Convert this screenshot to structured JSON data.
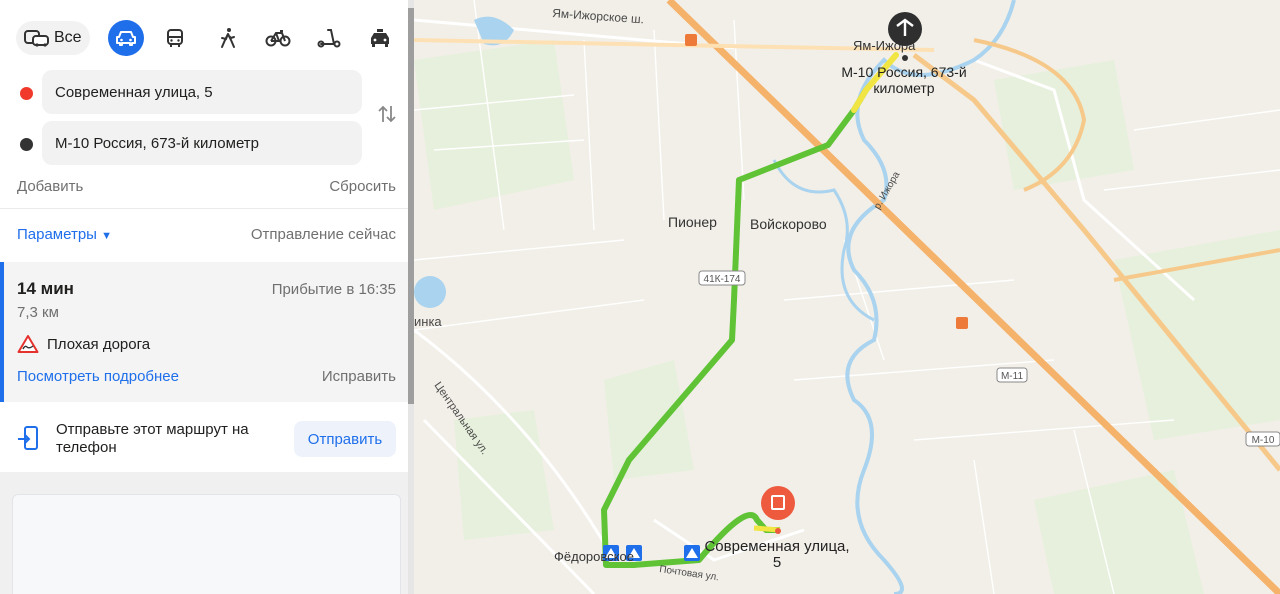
{
  "modes": {
    "all_label": "Все",
    "items": [
      "car-icon",
      "bus-icon",
      "walk-icon",
      "bicycle-icon",
      "scooter-icon",
      "taxi-icon"
    ],
    "active": "car-icon"
  },
  "route": {
    "from": "Современная улица, 5",
    "to": "М-10 Россия, 673-й километр",
    "add_label": "Добавить",
    "reset_label": "Сбросить"
  },
  "params": {
    "label": "Параметры",
    "departure": "Отправление сейчас"
  },
  "result": {
    "time": "14 мин",
    "distance": "7,3 км",
    "arrival": "Прибытие в 16:35",
    "warning": "Плохая дорога",
    "details_link": "Посмотреть подробнее",
    "fix_link": "Исправить"
  },
  "send": {
    "text": "Отправьте этот маршрут на телефон",
    "button": "Отправить"
  },
  "map": {
    "labels": {
      "road_north": "Ям-Ижорское ш.",
      "town_yam": "Ям-Ижора",
      "dest_line1": "М-10 Россия, 673-й",
      "dest_line2": "километр",
      "pioner": "Пионер",
      "voiskorovo": "Войскорово",
      "road_41k": "41К-174",
      "river": "р. Ижора",
      "inka": "инка",
      "central_st": "Центральная ул.",
      "m11": "М-11",
      "m10": "М-10",
      "fedorovskoe": "Фёдоровское",
      "pochtovaya": "Почтовая ул.",
      "origin_line1": "Современная улица,",
      "origin_line2": "5"
    },
    "colors": {
      "route_main": "#5fc335",
      "route_slow": "#f0e542",
      "highway": "#f5b26b",
      "accent": "#1f6feb",
      "origin_pin": "#ee5a3e"
    }
  }
}
